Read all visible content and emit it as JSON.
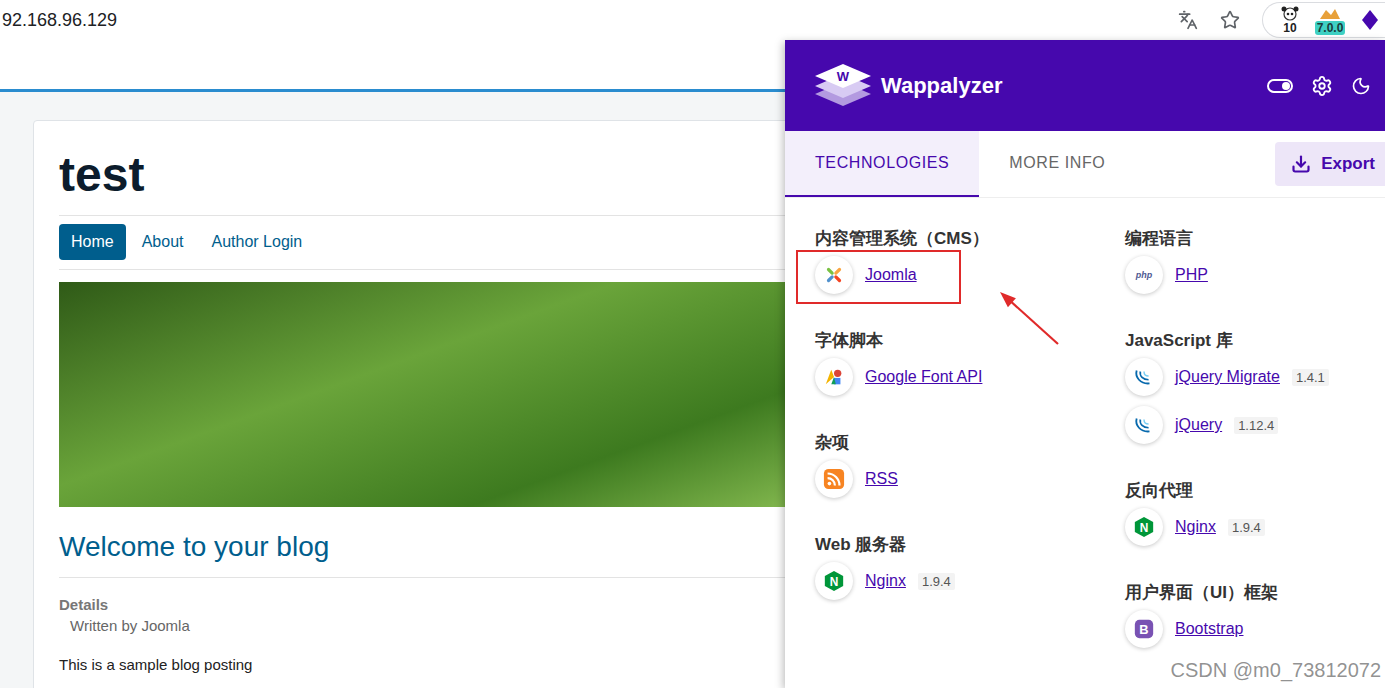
{
  "browser": {
    "address": "92.168.96.129",
    "extensions": [
      {
        "kind": "panda",
        "badge": "10"
      },
      {
        "kind": "tag",
        "badge": "7.0.0"
      },
      {
        "kind": "wappalyzer"
      }
    ]
  },
  "page": {
    "site_title": "test",
    "nav": [
      {
        "label": "Home",
        "selected": true
      },
      {
        "label": "About",
        "selected": false
      },
      {
        "label": "Author Login",
        "selected": false
      }
    ],
    "article": {
      "title": "Welcome to your blog",
      "details_label": "Details",
      "author": "Written by Joomla",
      "body": "This is a sample blog posting"
    }
  },
  "wappalyzer": {
    "title": "Wappalyzer",
    "logo_letter": "W",
    "tabs": [
      {
        "label": "TECHNOLOGIES",
        "selected": true
      },
      {
        "label": "MORE INFO",
        "selected": false
      }
    ],
    "export": "Export",
    "columns": [
      [
        {
          "category": "内容管理系统（CMS）",
          "items": [
            {
              "name": "Joomla",
              "icon": "joomla",
              "highlighted": true
            }
          ]
        },
        {
          "category": "字体脚本",
          "items": [
            {
              "name": "Google Font API",
              "icon": "googlefont",
              "highlighted": false
            }
          ]
        },
        {
          "category": "杂项",
          "items": [
            {
              "name": "RSS",
              "icon": "rss",
              "highlighted": false
            }
          ]
        },
        {
          "category": "Web 服务器",
          "items": [
            {
              "name": "Nginx",
              "version": "1.9.4",
              "icon": "nginx",
              "icon_text": "N",
              "highlighted": false
            }
          ]
        }
      ],
      [
        {
          "category": "编程语言",
          "items": [
            {
              "name": "PHP",
              "icon": "php",
              "icon_text": "php",
              "highlighted": false
            }
          ]
        },
        {
          "category": "JavaScript 库",
          "items": [
            {
              "name": "jQuery Migrate",
              "version": "1.4.1",
              "icon": "jquery",
              "highlighted": false
            },
            {
              "name": "jQuery",
              "version": "1.12.4",
              "icon": "jquery",
              "highlighted": false
            }
          ]
        },
        {
          "category": "反向代理",
          "items": [
            {
              "name": "Nginx",
              "version": "1.9.4",
              "icon": "nginx",
              "icon_text": "N",
              "highlighted": false
            }
          ]
        },
        {
          "category": "用户界面（UI）框架",
          "items": [
            {
              "name": "Bootstrap",
              "icon": "bootstrap",
              "icon_text": "B",
              "highlighted": false
            }
          ]
        }
      ]
    ]
  },
  "watermark": "CSDN @m0_73812072"
}
